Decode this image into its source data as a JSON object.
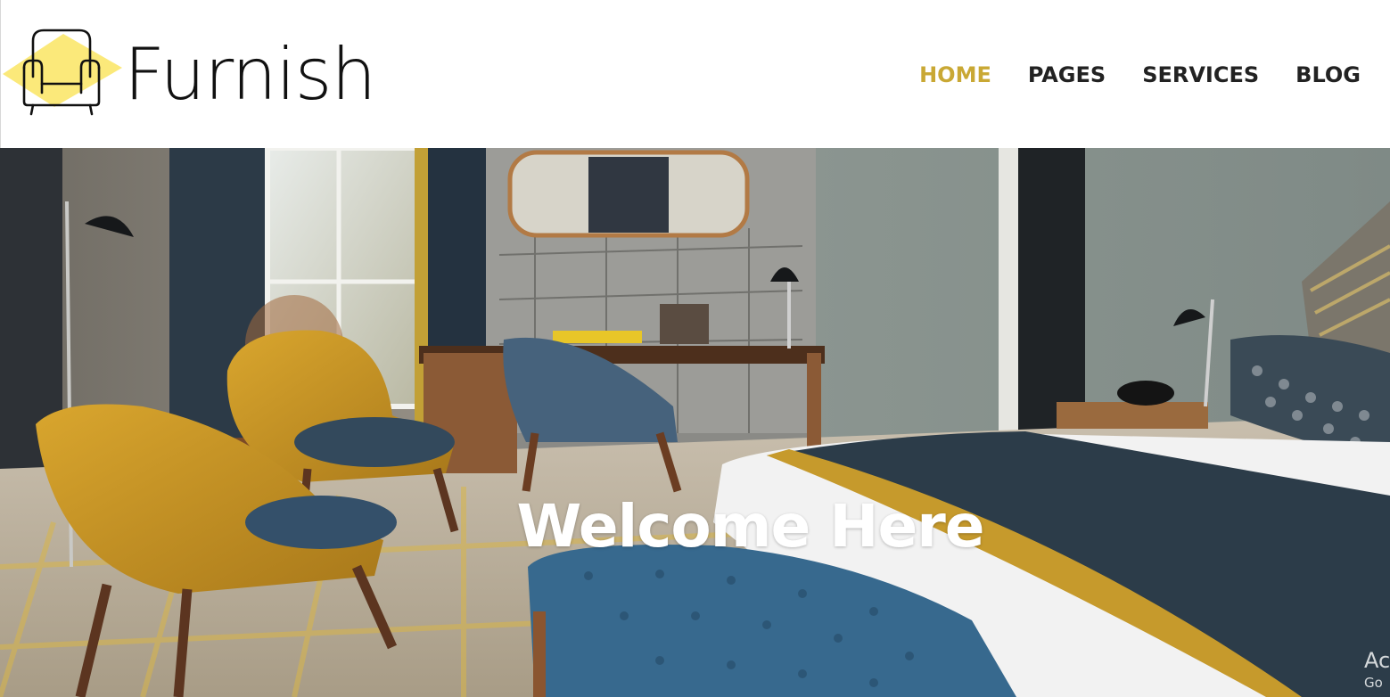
{
  "brand": {
    "name": "Furnish",
    "logo_icon": "armchair-icon",
    "logo_colors": {
      "blob": "#fbe97a",
      "outline": "#111111"
    }
  },
  "nav": {
    "items": [
      {
        "label": "HOME",
        "active": true
      },
      {
        "label": "PAGES",
        "active": false
      },
      {
        "label": "SERVICES",
        "active": false
      },
      {
        "label": "BLOG",
        "active": false
      }
    ],
    "active_color": "#c9a834",
    "text_color": "#222222"
  },
  "hero": {
    "title": "Welcome Here",
    "image": "hotel bedroom interior with mustard armchairs, desk and bed"
  },
  "watermark": {
    "line1": "Ac",
    "line2": "Go"
  }
}
